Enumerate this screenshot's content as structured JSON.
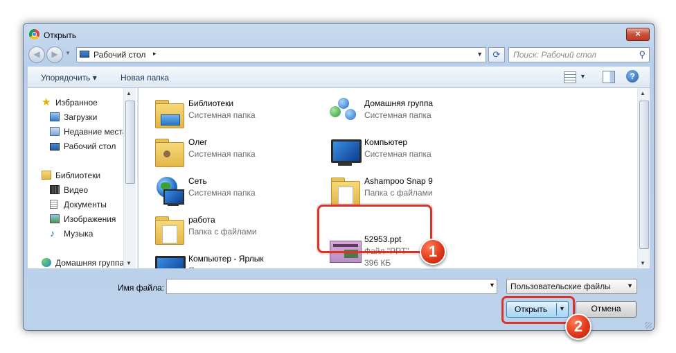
{
  "window": {
    "title": "Открыть",
    "close_symbol": "×"
  },
  "address": {
    "location": "Рабочий стол",
    "arrow": "▸",
    "search_placeholder": "Поиск: Рабочий стол"
  },
  "toolbar": {
    "organize": "Упорядочить ▾",
    "new_folder": "Новая папка",
    "help": "?"
  },
  "nav": {
    "favorites": "Избранное",
    "downloads": "Загрузки",
    "recent": "Недавние места",
    "desktop": "Рабочий стол",
    "libraries": "Библиотеки",
    "video": "Видео",
    "documents": "Документы",
    "images": "Изображения",
    "music": "Музыка",
    "homegroup": "Домашняя группа"
  },
  "files": [
    {
      "name": "Библиотеки",
      "type": "Системная папка"
    },
    {
      "name": "Олег",
      "type": "Системная папка"
    },
    {
      "name": "Сеть",
      "type": "Системная папка"
    },
    {
      "name": "работа",
      "type": "Папка с файлами"
    },
    {
      "name": "Компьютер - Ярлык",
      "type": "Ярлык"
    },
    {
      "name": "Домашняя группа",
      "type": "Системная папка"
    },
    {
      "name": "Компьютер",
      "type": "Системная папка"
    },
    {
      "name": "Ashampoo Snap 9",
      "type": "Папка с файлами"
    },
    {
      "name": "52953.ppt",
      "type": "Файл \"PPT\"",
      "size": "396 КБ"
    }
  ],
  "bottom": {
    "filename_label": "Имя файла:",
    "filename_value": "",
    "filetype": "Пользовательские файлы",
    "open": "Открыть",
    "cancel": "Отмена"
  },
  "badges": {
    "one": "1",
    "two": "2"
  },
  "colors": {
    "highlight": "#d9342b",
    "badge": "#e0391b"
  }
}
